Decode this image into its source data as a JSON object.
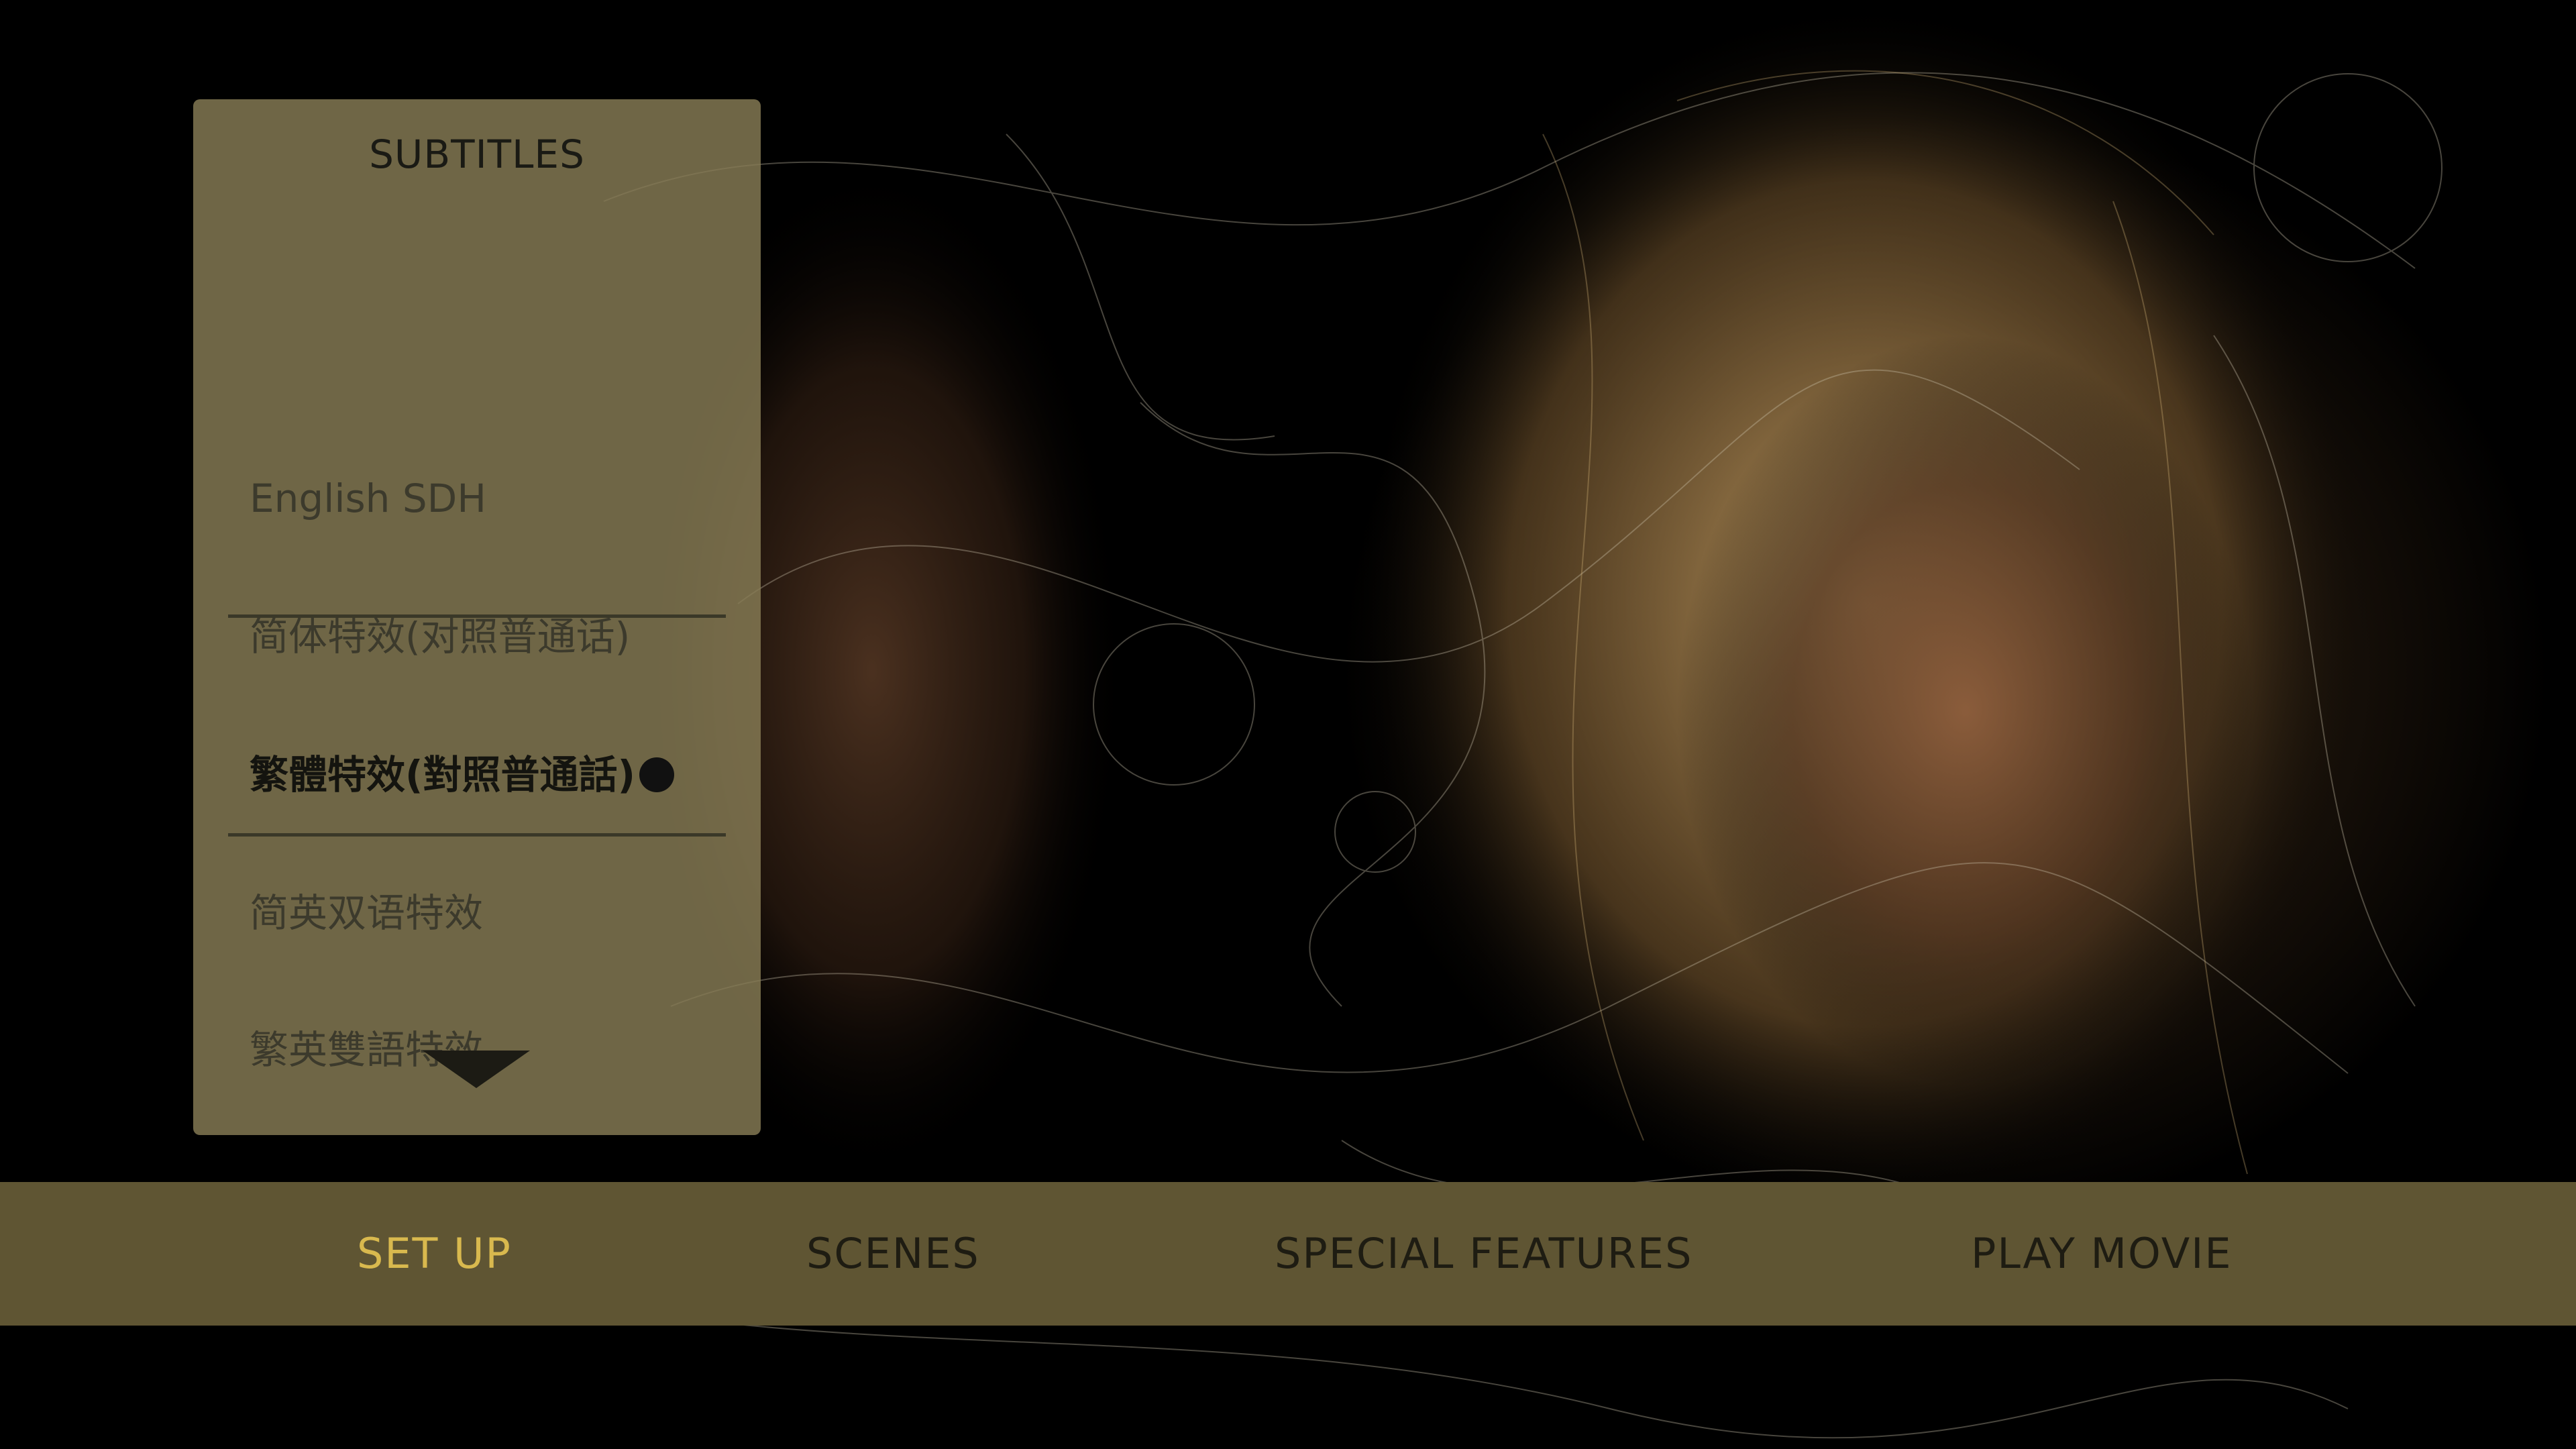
{
  "panel": {
    "title": "SUBTITLES",
    "options": [
      "English SDH",
      "简体特效(对照普通话)",
      "繁體特效(對照普通話)",
      "简英双语特效",
      "繁英雙語特效"
    ],
    "selected_index": 2,
    "more_icon": "chevron-down-icon"
  },
  "nav": {
    "items": [
      "SET UP",
      "SCENES",
      "SPECIAL FEATURES",
      "PLAY MOVIE"
    ],
    "active_index": 0
  },
  "colors": {
    "panel_bg": "#877d55",
    "navbar_bg": "#5f5533",
    "nav_active": "#d9b94e",
    "nav_text": "#1e1c12"
  }
}
